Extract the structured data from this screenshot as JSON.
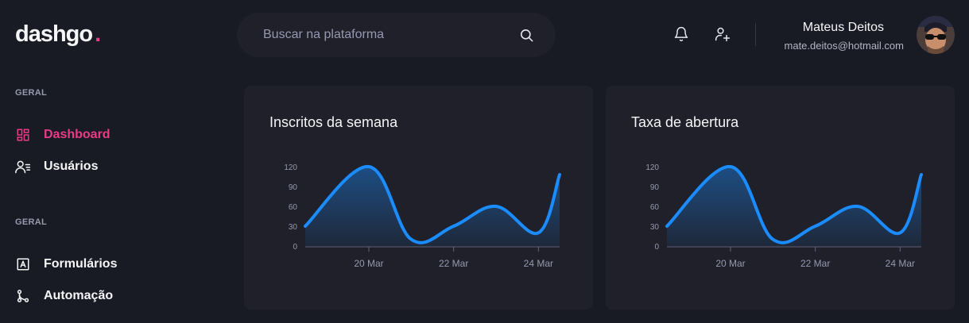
{
  "logo": {
    "text": "dashgo",
    "dot": "."
  },
  "search": {
    "placeholder": "Buscar na plataforma",
    "value": ""
  },
  "user": {
    "name": "Mateus Deitos",
    "email": "mate.deitos@hotmail.com"
  },
  "sidebar": {
    "sections": [
      {
        "title": "GERAL",
        "items": [
          {
            "label": "Dashboard",
            "icon": "dashboard-icon",
            "active": true
          },
          {
            "label": "Usuários",
            "icon": "users-icon",
            "active": false
          }
        ]
      },
      {
        "title": "GERAL",
        "items": [
          {
            "label": "Formulários",
            "icon": "form-icon",
            "active": false
          },
          {
            "label": "Automação",
            "icon": "git-branch-icon",
            "active": false
          }
        ]
      }
    ]
  },
  "colors": {
    "accent": "#e93b88",
    "line": "#1a8cff",
    "background": "#181b23",
    "card": "#1f2029"
  },
  "chart_data": [
    {
      "type": "area",
      "title": "Inscritos da semana",
      "x": [
        "2021-03-18T12:00",
        "2021-03-20T00:00",
        "2021-03-21T00:00",
        "2021-03-22T00:00",
        "2021-03-23T00:00",
        "2021-03-24T00:00",
        "2021-03-24T12:00"
      ],
      "y": [
        30,
        120,
        10,
        30,
        60,
        20,
        108
      ],
      "xticks": [
        "20 Mar",
        "22 Mar",
        "24 Mar"
      ],
      "yticks": [
        "0",
        "30",
        "60",
        "90",
        "120"
      ],
      "ylim": [
        0,
        120
      ],
      "grid": false
    },
    {
      "type": "area",
      "title": "Taxa de abertura",
      "x": [
        "2021-03-18T12:00",
        "2021-03-20T00:00",
        "2021-03-21T00:00",
        "2021-03-22T00:00",
        "2021-03-23T00:00",
        "2021-03-24T00:00",
        "2021-03-24T12:00"
      ],
      "y": [
        30,
        120,
        10,
        30,
        60,
        20,
        108
      ],
      "xticks": [
        "20 Mar",
        "22 Mar",
        "24 Mar"
      ],
      "yticks": [
        "0",
        "30",
        "60",
        "90",
        "120"
      ],
      "ylim": [
        0,
        120
      ],
      "grid": false
    }
  ]
}
